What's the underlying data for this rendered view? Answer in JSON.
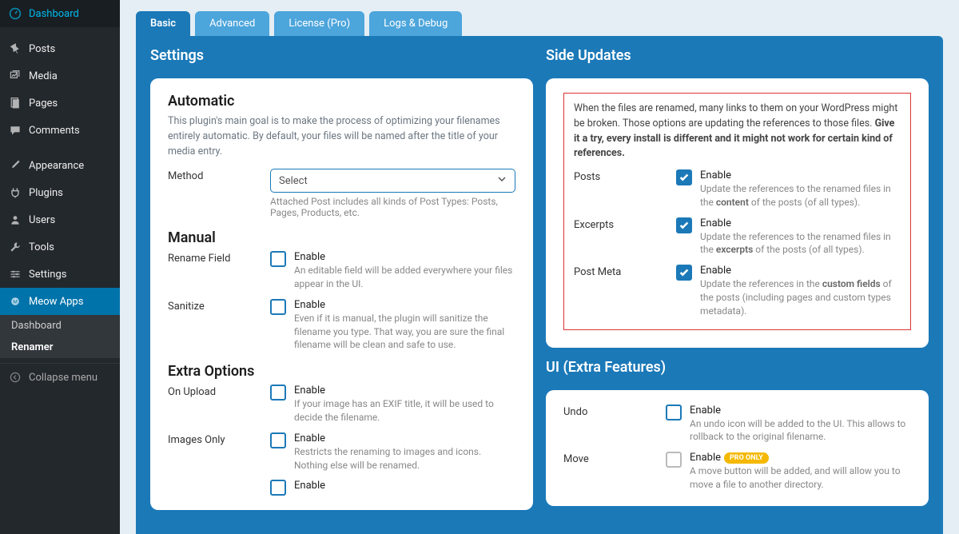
{
  "sidebar": {
    "items": [
      {
        "label": "Dashboard",
        "icon": "dashboard"
      },
      {
        "label": "Posts",
        "icon": "pin"
      },
      {
        "label": "Media",
        "icon": "media"
      },
      {
        "label": "Pages",
        "icon": "pages"
      },
      {
        "label": "Comments",
        "icon": "comment"
      },
      {
        "label": "Appearance",
        "icon": "brush"
      },
      {
        "label": "Plugins",
        "icon": "plug"
      },
      {
        "label": "Users",
        "icon": "user"
      },
      {
        "label": "Tools",
        "icon": "wrench"
      },
      {
        "label": "Settings",
        "icon": "sliders"
      },
      {
        "label": "Meow Apps",
        "icon": "meow"
      }
    ],
    "subitems": [
      {
        "label": "Dashboard"
      },
      {
        "label": "Renamer"
      }
    ],
    "collapse": "Collapse menu"
  },
  "tabs": [
    {
      "label": "Basic"
    },
    {
      "label": "Advanced"
    },
    {
      "label": "License (Pro)"
    },
    {
      "label": "Logs & Debug"
    }
  ],
  "left": {
    "title": "Settings",
    "automatic": {
      "heading": "Automatic",
      "desc": "This plugin's main goal is to make the process of optimizing your filenames entirely automatic. By default, your files will be named after the title of your media entry.",
      "method_label": "Method",
      "select_placeholder": "Select",
      "select_hint": "Attached Post includes all kinds of Post Types: Posts, Pages, Products, etc."
    },
    "manual": {
      "heading": "Manual",
      "rename": {
        "label": "Rename Field",
        "title": "Enable",
        "sub": "An editable field will be added everywhere your files appear in the UI."
      },
      "sanitize": {
        "label": "Sanitize",
        "title": "Enable",
        "sub": "Even if it is manual, the plugin will sanitize the filename you type. That way, you are sure the final filename will be clean and safe to use."
      }
    },
    "extra": {
      "heading": "Extra Options",
      "upload": {
        "label": "On Upload",
        "title": "Enable",
        "sub": "If your image has an EXIF title, it will be used to decide the filename."
      },
      "images": {
        "label": "Images Only",
        "title": "Enable",
        "sub": "Restricts the renaming to images and icons. Nothing else will be renamed."
      },
      "cut": {
        "title": "Enable"
      }
    }
  },
  "right": {
    "side_updates_title": "Side Updates",
    "notice": {
      "text": "When the files are renamed, many links to them on your WordPress might be broken. Those options are updating the references to those files. ",
      "bold": "Give it a try, every install is different and it might not work for certain kind of references."
    },
    "posts": {
      "label": "Posts",
      "title": "Enable",
      "sub_pre": "Update the references to the renamed files in the ",
      "sub_b": "content",
      "sub_post": " of the posts (of all types)."
    },
    "excerpts": {
      "label": "Excerpts",
      "title": "Enable",
      "sub_pre": "Update the references to the renamed files in the ",
      "sub_b": "excerpts",
      "sub_post": " of the posts (of all types)."
    },
    "postmeta": {
      "label": "Post Meta",
      "title": "Enable",
      "sub_pre": "Update the references in the ",
      "sub_b": "custom fields",
      "sub_post": " of the posts (including pages and custom types metadata)."
    },
    "ui_title": "UI (Extra Features)",
    "undo": {
      "label": "Undo",
      "title": "Enable",
      "sub": "An undo icon will be added to the UI. This allows to rollback to the original filename."
    },
    "move": {
      "label": "Move",
      "title": "Enable",
      "badge": "PRO ONLY",
      "sub": "A move button will be added, and will allow you to move a file to another directory."
    }
  }
}
